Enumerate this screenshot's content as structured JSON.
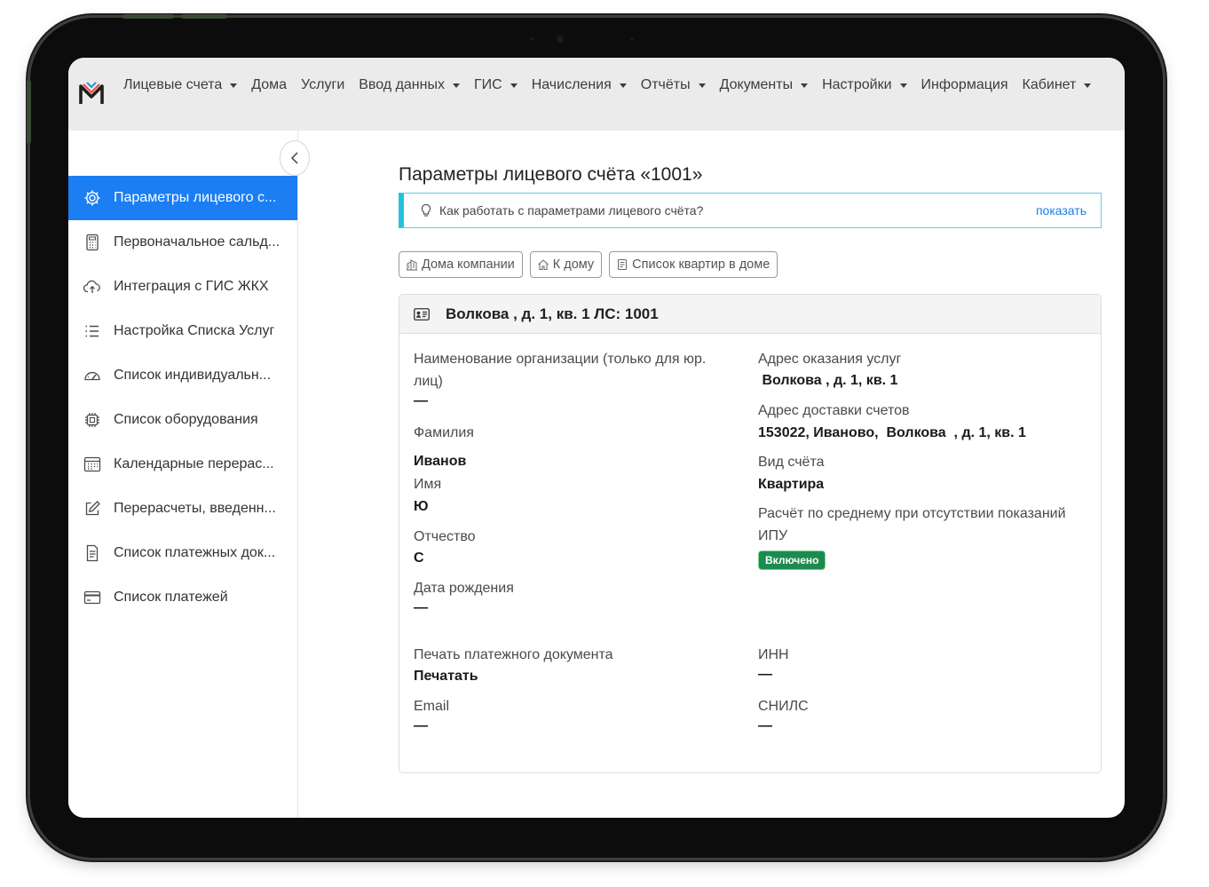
{
  "navbar": {
    "items": [
      {
        "label": "Лицевые счета",
        "dropdown": true
      },
      {
        "label": "Дома",
        "dropdown": false
      },
      {
        "label": "Услуги",
        "dropdown": false
      },
      {
        "label": "Ввод данных",
        "dropdown": true
      },
      {
        "label": "ГИС",
        "dropdown": true
      },
      {
        "label": "Начисления",
        "dropdown": true
      },
      {
        "label": "Отчёты",
        "dropdown": true
      },
      {
        "label": "Документы",
        "dropdown": true
      },
      {
        "label": "Настройки",
        "dropdown": true
      },
      {
        "label": "Информация",
        "dropdown": false
      },
      {
        "label": "Кабинет",
        "dropdown": true
      }
    ]
  },
  "sidebar": {
    "items": [
      {
        "label": "Параметры лицевого с...",
        "icon": "gear-icon",
        "active": true
      },
      {
        "label": "Первоначальное сальд...",
        "icon": "calculator-icon",
        "active": false
      },
      {
        "label": "Интеграция с ГИС ЖКХ",
        "icon": "cloud-upload-icon",
        "active": false
      },
      {
        "label": "Настройка Списка Услуг",
        "icon": "list-icon",
        "active": false
      },
      {
        "label": "Список индивидуальн...",
        "icon": "speedometer-icon",
        "active": false
      },
      {
        "label": "Список оборудования",
        "icon": "cpu-icon",
        "active": false
      },
      {
        "label": "Календарные перерас...",
        "icon": "calendar-icon",
        "active": false
      },
      {
        "label": "Перерасчеты, введенн...",
        "icon": "edit-icon",
        "active": false
      },
      {
        "label": "Список платежных док...",
        "icon": "document-icon",
        "active": false
      },
      {
        "label": "Список платежей",
        "icon": "credit-card-icon",
        "active": false
      }
    ]
  },
  "main": {
    "title": "Параметры лицевого счёта «1001»",
    "hint": {
      "text": "Как работать с параметрами лицевого счёта?",
      "link": "показать"
    },
    "buttons": [
      {
        "label": "Дома компании",
        "icon": "building-icon"
      },
      {
        "label": "К дому",
        "icon": "home-icon"
      },
      {
        "label": "Список квартир в доме",
        "icon": "list-doc-icon"
      }
    ],
    "card": {
      "header": "Волкова , д. 1, кв. 1 ЛС: 1001",
      "left": {
        "org_label": "Наименование организации (только для юр. лиц)",
        "org_value": "—",
        "surname_label": "Фамилия",
        "surname_value": "Иванов",
        "name_label": "Имя",
        "name_value": "Ю",
        "patronymic_label": "Отчество",
        "patronymic_value": "С",
        "birth_label": "Дата рождения",
        "birth_value": "—",
        "print_label": "Печать платежного документа",
        "print_value": "Печатать",
        "email_label": "Email",
        "email_value": "—"
      },
      "right": {
        "service_addr_label": "Адрес оказания услуг",
        "service_addr_value": " Волкова , д. 1, кв. 1",
        "delivery_addr_label": "Адрес доставки счетов",
        "delivery_addr_value": "153022, Иваново,  Волкова  , д. 1, кв. 1",
        "account_type_label": "Вид счёта",
        "account_type_value": "Квартира",
        "avg_label": "Расчёт по среднему при отсутствии показаний ИПУ",
        "avg_badge": "Включено",
        "inn_label": "ИНН",
        "inn_value": "—",
        "snils_label": "СНИЛС",
        "snils_value": "—"
      }
    }
  },
  "colors": {
    "accent": "#1b7ef3",
    "info_border": "#25c1de",
    "success": "#1c8c4e",
    "navbar_bg": "#ebebeb"
  }
}
